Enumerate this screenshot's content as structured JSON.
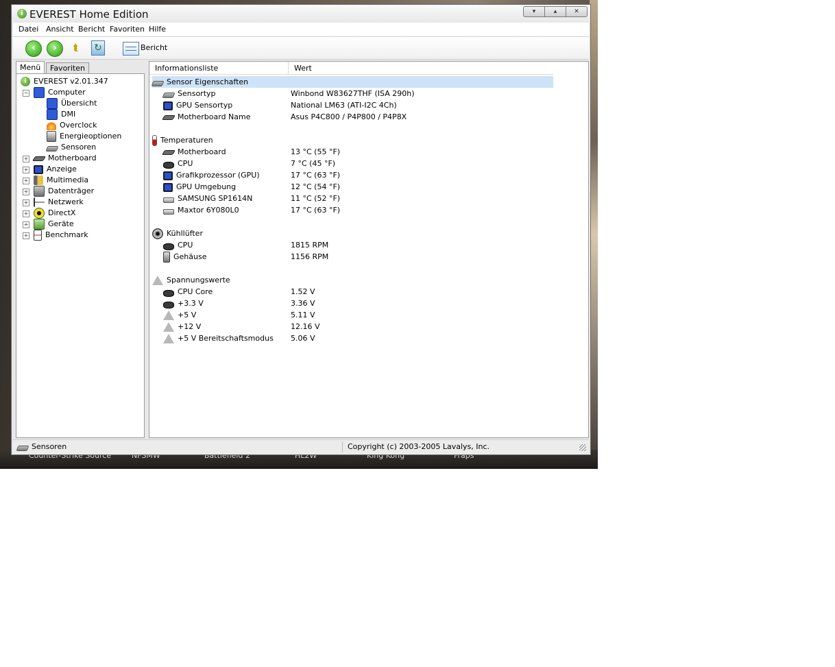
{
  "window": {
    "title": "EVEREST Home Edition",
    "buttons": {
      "minimize": "▾",
      "maximize": "▴",
      "close": "✕"
    }
  },
  "menu": [
    "Datei",
    "Ansicht",
    "Bericht",
    "Favoriten",
    "Hilfe"
  ],
  "toolbar": {
    "report_label": "Bericht"
  },
  "tabs": {
    "menu": "Menü",
    "favorites": "Favoriten"
  },
  "tree": {
    "root": "EVEREST v2.01.347",
    "computer": "Computer",
    "computer_children": [
      "Übersicht",
      "DMI",
      "Overclock",
      "Energieoptionen",
      "Sensoren"
    ],
    "categories": [
      "Motherboard",
      "Anzeige",
      "Multimedia",
      "Datenträger",
      "Netzwerk",
      "DirectX",
      "Geräte",
      "Benchmark"
    ]
  },
  "columns": {
    "field": "Informationsliste",
    "value": "Wert"
  },
  "sections": {
    "sensor": {
      "title": "Sensor Eigenschaften",
      "rows": [
        {
          "label": "Sensortyp",
          "value": "Winbond W83627THF  (ISA 290h)"
        },
        {
          "label": "GPU Sensortyp",
          "value": "National LM63  (ATI-I2C 4Ch)"
        },
        {
          "label": "Motherboard Name",
          "value": "Asus P4C800 / P4P800 / P4P8X"
        }
      ]
    },
    "temps": {
      "title": "Temperaturen",
      "rows": [
        {
          "label": "Motherboard",
          "value": "13 °C  (55 °F)"
        },
        {
          "label": "CPU",
          "value": "7 °C  (45 °F)"
        },
        {
          "label": "Grafikprozessor (GPU)",
          "value": "17 °C  (63 °F)"
        },
        {
          "label": "GPU Umgebung",
          "value": "12 °C  (54 °F)"
        },
        {
          "label": "SAMSUNG SP1614N",
          "value": "11 °C  (52 °F)"
        },
        {
          "label": "Maxtor 6Y080L0",
          "value": "17 °C  (63 °F)"
        }
      ]
    },
    "fans": {
      "title": "Kühllüfter",
      "rows": [
        {
          "label": "CPU",
          "value": "1815 RPM"
        },
        {
          "label": "Gehäuse",
          "value": "1156 RPM"
        }
      ]
    },
    "volts": {
      "title": "Spannungswerte",
      "rows": [
        {
          "label": "CPU Core",
          "value": "1.52 V"
        },
        {
          "label": "+3.3 V",
          "value": "3.36 V"
        },
        {
          "label": "+5 V",
          "value": "5.11 V"
        },
        {
          "label": "+12 V",
          "value": "12.16 V"
        },
        {
          "label": "+5 V Bereitschaftsmodus",
          "value": "5.06 V"
        }
      ]
    }
  },
  "status": {
    "left": "Sensoren",
    "right": "Copyright (c) 2003-2005 Lavalys, Inc."
  },
  "taskbar": [
    "Counter-Strike Source",
    "NFSMW",
    "Battlefield 2",
    "HL2W",
    "King Kong",
    "Fraps"
  ]
}
